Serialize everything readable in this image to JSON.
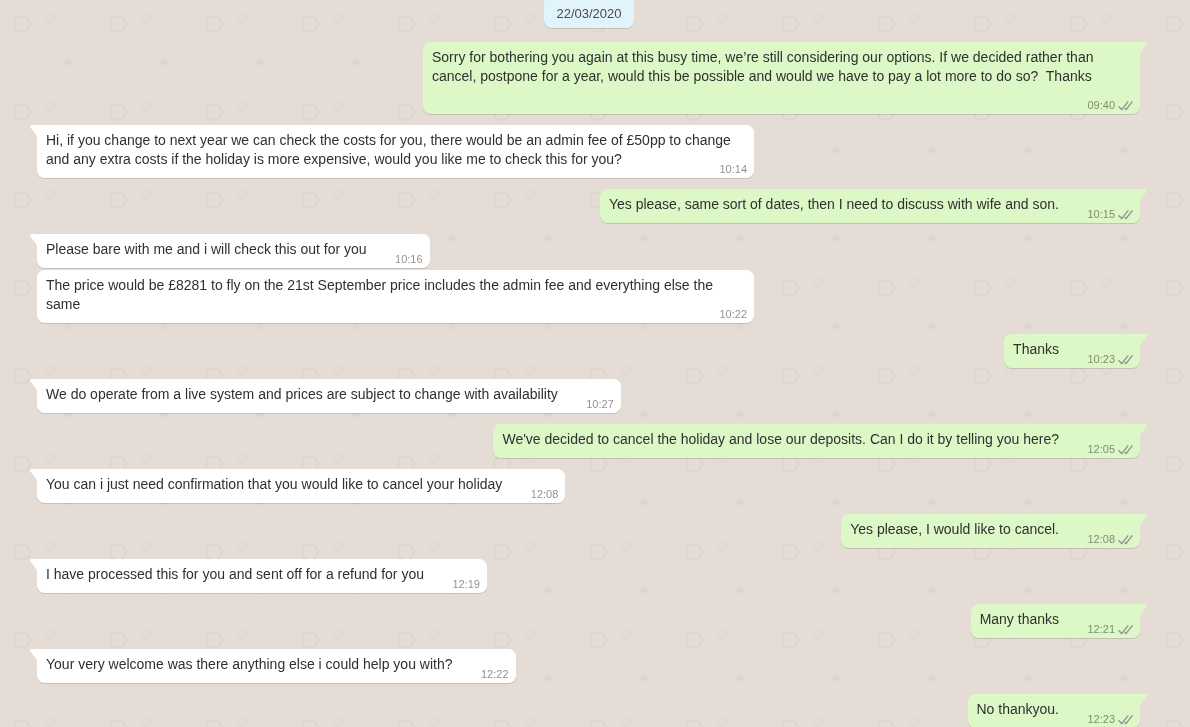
{
  "date_chip": "22/03/2020",
  "messages": [
    {
      "kind": "outgoing",
      "tail": true,
      "text": "Sorry for bothering you again at this busy time, we’re still considering our options. If we decided rather than cancel, postpone for a year, would this be possible and would we have to pay a lot more to do so?  Thanks",
      "time": "09:40",
      "read": false
    },
    {
      "kind": "incoming",
      "tail": true,
      "text": "Hi, if you change to next year we can check the costs for you, there would be an admin fee of £50pp to change and any extra costs if the holiday is more expensive, would you like me to check this for you?",
      "time": "10:14"
    },
    {
      "kind": "outgoing",
      "tail": true,
      "text": "Yes please, same sort of dates, then I need to discuss with wife and son.",
      "time": "10:15",
      "read": false
    },
    {
      "kind": "incoming",
      "tail": true,
      "text": "Please bare with me and i will check this out for you",
      "time": "10:16"
    },
    {
      "kind": "incoming",
      "tail": false,
      "text": "The price would be £8281 to fly on the 21st September price includes the admin fee and everything else the same",
      "time": "10:22"
    },
    {
      "kind": "outgoing",
      "tail": true,
      "text": "Thanks",
      "time": "10:23",
      "read": false
    },
    {
      "kind": "incoming",
      "tail": true,
      "text": "We do operate from a live system and prices are subject to change with availability",
      "time": "10:27"
    },
    {
      "kind": "outgoing",
      "tail": true,
      "text": "We've decided to cancel the holiday and lose our deposits. Can I do it by telling you here?",
      "time": "12:05",
      "read": false
    },
    {
      "kind": "incoming",
      "tail": true,
      "text": "You can i just need confirmation that you would like to cancel your holiday",
      "time": "12:08"
    },
    {
      "kind": "outgoing",
      "tail": true,
      "text": "Yes please, I would like to cancel.",
      "time": "12:08",
      "read": false
    },
    {
      "kind": "incoming",
      "tail": true,
      "text": "I have processed this for you and sent off for a refund for you",
      "time": "12:19"
    },
    {
      "kind": "outgoing",
      "tail": true,
      "text": "Many thanks",
      "time": "12:21",
      "read": false
    },
    {
      "kind": "incoming",
      "tail": true,
      "text": "Your very welcome was there anything else i could help you with?",
      "time": "12:22"
    },
    {
      "kind": "outgoing",
      "tail": true,
      "text": "No thankyou.",
      "time": "12:23",
      "read": false
    }
  ]
}
